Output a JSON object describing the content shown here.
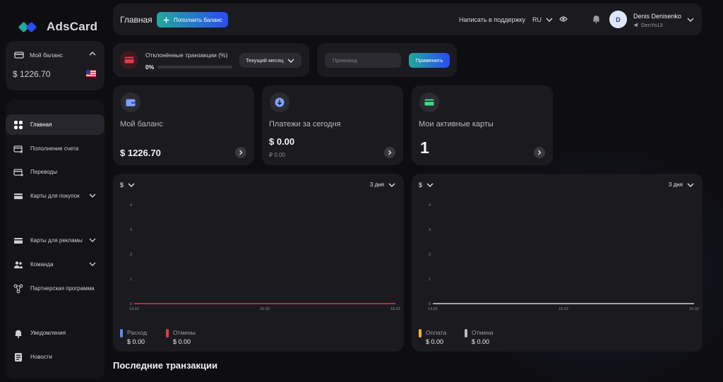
{
  "brand": {
    "logo_text": "AdsCard"
  },
  "balance_widget": {
    "label": "Мой баланс",
    "amount": "$ 1226.70"
  },
  "sidebar": {
    "items": [
      {
        "label": "Главная",
        "active": true
      },
      {
        "label": "Пополнение счета"
      },
      {
        "label": "Переводы"
      },
      {
        "label": "Карты для покупок"
      },
      {
        "label": "Карты для рекламы"
      },
      {
        "label": "Команда"
      },
      {
        "label": "Партнерская программа"
      },
      {
        "label": "Уведомления"
      },
      {
        "label": "Новости"
      }
    ]
  },
  "header": {
    "title": "Главная",
    "topup_label": "Пополнить баланс",
    "support_label": "Написать в поддержку",
    "language": "RU",
    "user_name": "Denis Denisenko",
    "user_handle": "DenYo13",
    "avatar_letter": "D"
  },
  "rejected": {
    "label": "Отклонённые транзакции (%)",
    "percent": "0%",
    "progress": 0,
    "period": "Текущий месяц"
  },
  "promo": {
    "placeholder": "Промокод",
    "apply_label": "Применить"
  },
  "stats": {
    "balance": {
      "label": "Мой баланс",
      "value": "$ 1226.70"
    },
    "payments_today": {
      "label": "Платежи за сегодня",
      "value": "$ 0.00",
      "sub": "₽ 0.00"
    },
    "active_cards": {
      "label": "Мои активные карты",
      "value": "1"
    }
  },
  "chart_data": [
    {
      "type": "line",
      "currency": "$",
      "range": "3 дня",
      "x": [
        "14.02",
        "15.02",
        "16.02"
      ],
      "ylim": [
        0,
        4
      ],
      "yticks": [
        0,
        1,
        2,
        3,
        4
      ],
      "series": [
        {
          "name": "Расход",
          "values": [
            0,
            0,
            0
          ],
          "color": "#5b8cff",
          "total": "$ 0.00"
        },
        {
          "name": "Отмены",
          "values": [
            0,
            0,
            0
          ],
          "color": "#e23c4a",
          "total": "$ 0.00"
        }
      ],
      "line_color": "#e23c4a"
    },
    {
      "type": "line",
      "currency": "$",
      "range": "3 дня",
      "x": [
        "14.02",
        "15.02",
        "16.02"
      ],
      "ylim": [
        0,
        4
      ],
      "yticks": [
        0,
        1,
        2,
        3,
        4
      ],
      "series": [
        {
          "name": "Оплата",
          "values": [
            0,
            0,
            0
          ],
          "color": "#f4b418",
          "total": "$ 0.00"
        },
        {
          "name": "Отмена",
          "values": [
            0,
            0,
            0
          ],
          "color": "#b7b7bd",
          "total": "$ 0.00"
        }
      ],
      "line_color": "#d9d9dc"
    }
  ],
  "recent": {
    "title": "Последние транзакции"
  },
  "colors": {
    "accent_start": "#1fa99a",
    "accent_end": "#2a4cf0",
    "bg": "#0e0e11",
    "card": "#1a1a1f"
  }
}
